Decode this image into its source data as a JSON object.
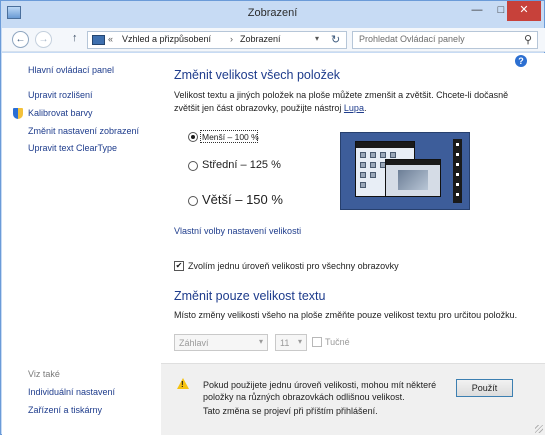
{
  "window": {
    "title": "Zobrazení",
    "min_glyph": "—",
    "max_glyph": "□",
    "close_glyph": "✕"
  },
  "nav": {
    "back_glyph": "←",
    "fwd_glyph": "→",
    "up_glyph": "↑",
    "address_chevron": "«",
    "breadcrumb": [
      "Vzhled a přizpůsobení",
      "Zobrazení"
    ],
    "crumb_sep": "›",
    "dropdown_glyph": "▾",
    "refresh_glyph": "↻",
    "search_placeholder": "Prohledat Ovládací panely",
    "search_glyph": "⚲"
  },
  "sidebar": {
    "home": "Hlavní ovládací panel",
    "items": [
      "Upravit rozlišení",
      "Kalibrovat barvy",
      "Změnit nastavení zobrazení",
      "Upravit text ClearType"
    ],
    "see_also_label": "Viz také",
    "see_also": [
      "Individuální nastavení",
      "Zařízení a tiskárny"
    ]
  },
  "main": {
    "help_glyph": "?",
    "heading1": "Změnit velikost všech položek",
    "desc1_text": "Velikost textu a jiných položek na ploše můžete zmenšit a zvětšit. Chcete-li dočasně zvětšit jen část obrazovky, použijte nástroj ",
    "desc1_link": "Lupa",
    "desc1_end": ".",
    "radios": [
      {
        "label": "Menší – 100 %",
        "checked": true
      },
      {
        "label": "Střední – 125 %",
        "checked": false
      },
      {
        "label": "Větší – 150 %",
        "checked": false
      }
    ],
    "custom_link": "Vlastní volby nastavení velikosti",
    "single_scale_label": "Zvolím jednu úroveň velikosti pro všechny obrazovky",
    "single_scale_checked": true,
    "heading2": "Změnit pouze velikost textu",
    "desc2": "Místo změny velikosti všeho na ploše změňte pouze velikost textu pro určitou položku.",
    "item_select": "Záhlaví",
    "size_select": "11",
    "bold_label": "Tučné",
    "select_arrow": "▾",
    "check_glyph": "✔"
  },
  "footer": {
    "warning_line1": "Pokud použijete jednu úroveň velikosti, mohou mít některé",
    "warning_line2": "položky na různých obrazovkách odlišnou velikost.",
    "note": "Tato změna se projeví při příštím přihlášení.",
    "apply": "Použít",
    "warn_glyph": "!"
  },
  "colors": {
    "link": "#1e3c8c",
    "title_bar": "#c7dbf4",
    "close_button": "#c7413a",
    "preview_desktop": "#3d5d9a"
  }
}
